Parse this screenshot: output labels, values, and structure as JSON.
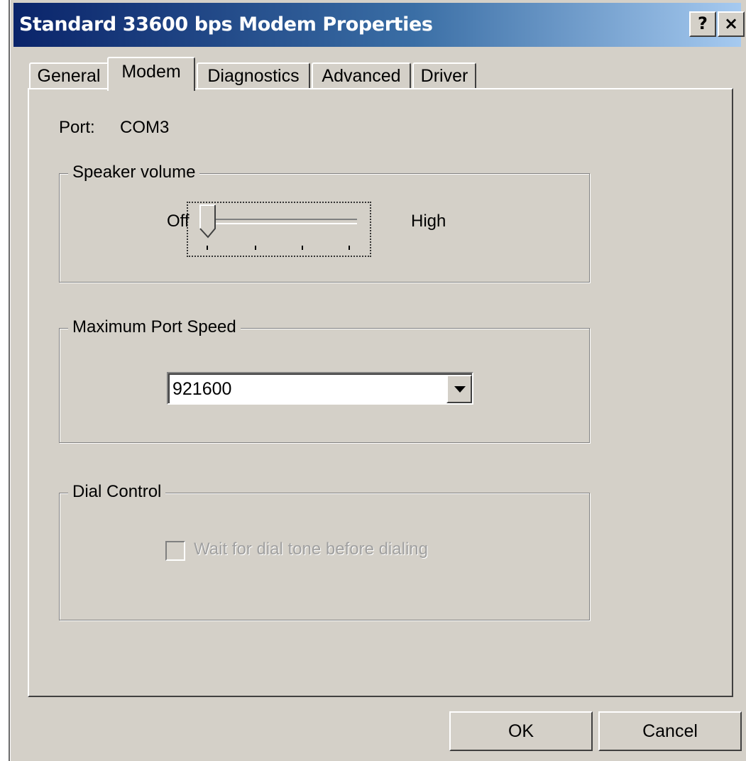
{
  "window": {
    "title": "Standard 33600 bps Modem Properties",
    "help_button": "?",
    "close_button": "×"
  },
  "tabs": [
    {
      "label": "General",
      "active": false
    },
    {
      "label": "Modem",
      "active": true
    },
    {
      "label": "Diagnostics",
      "active": false
    },
    {
      "label": "Advanced",
      "active": false
    },
    {
      "label": "Driver",
      "active": false
    }
  ],
  "modem": {
    "port_label": "Port:",
    "port_value": "COM3",
    "speaker_volume": {
      "group_title": "Speaker volume",
      "min_label": "Off",
      "max_label": "High",
      "level_fraction": 0
    },
    "max_port_speed": {
      "group_title": "Maximum Port Speed",
      "selected": "921600"
    },
    "dial_control": {
      "group_title": "Dial Control",
      "checkbox_label": "Wait for dial tone before dialing",
      "checked": false,
      "enabled": false
    }
  },
  "buttons": {
    "ok": "OK",
    "cancel": "Cancel"
  }
}
